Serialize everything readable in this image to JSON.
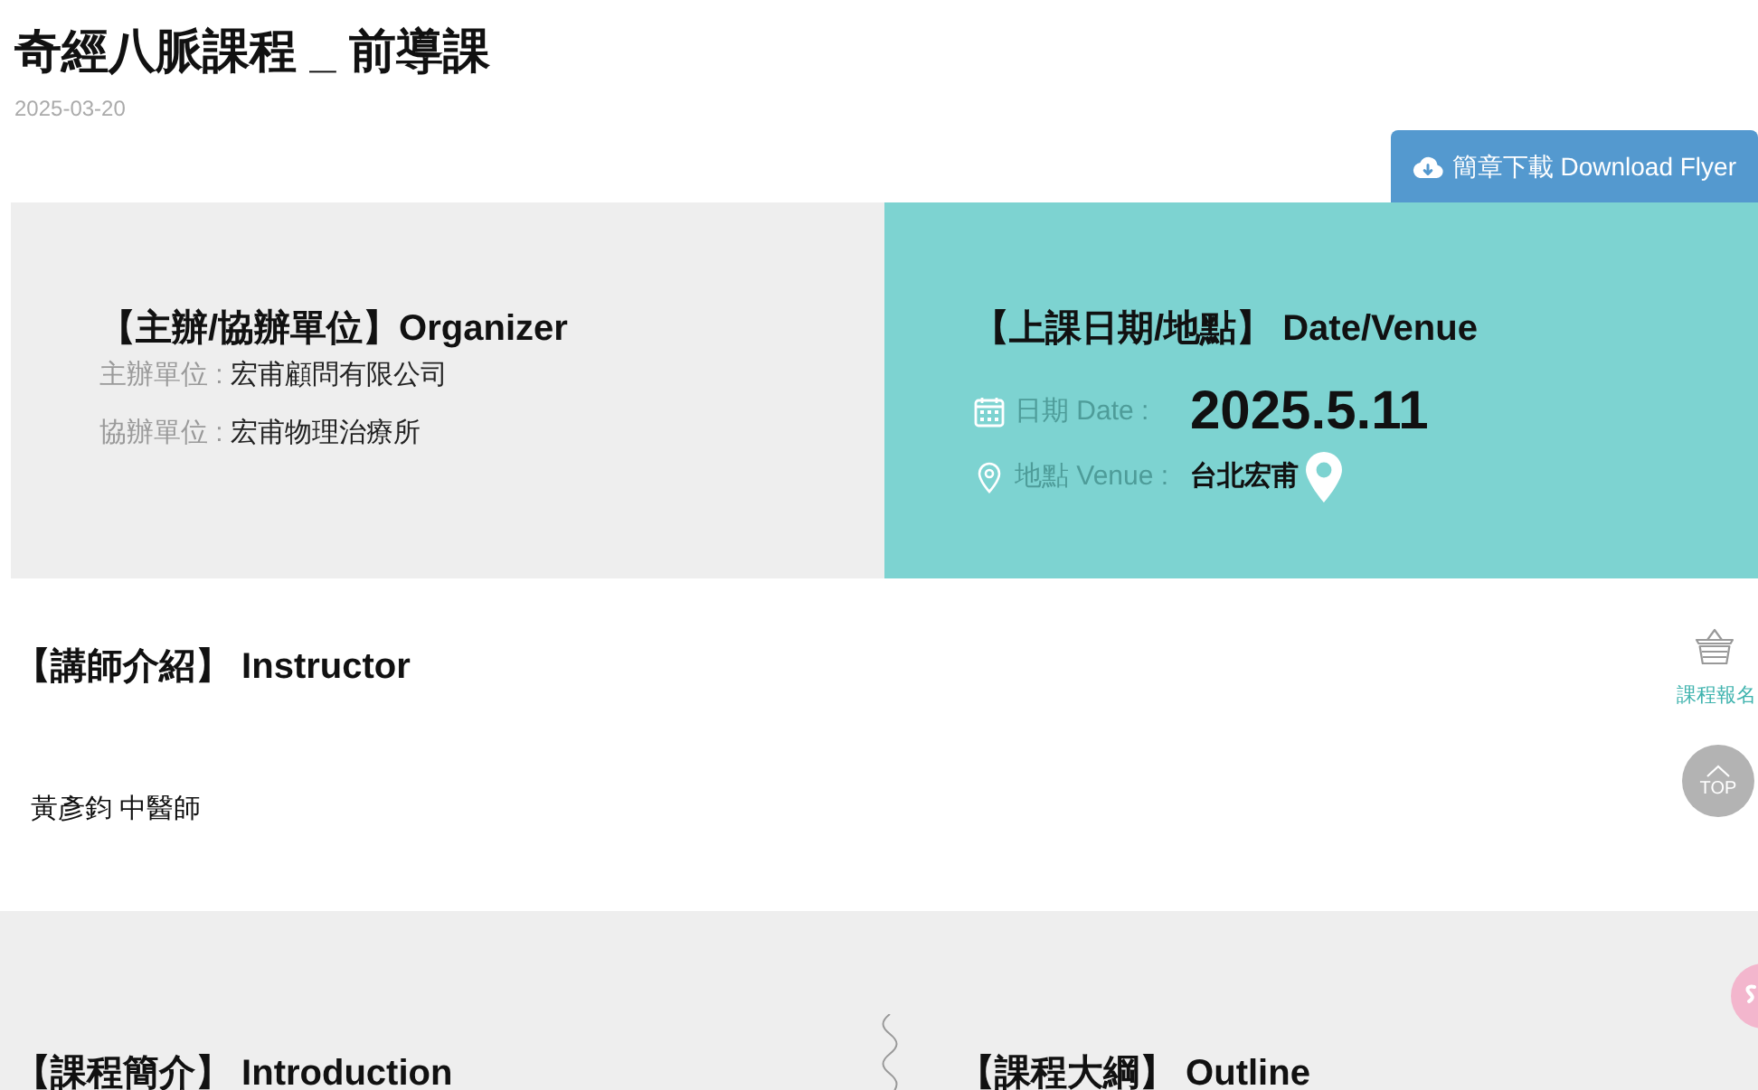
{
  "header": {
    "title": "奇經八脈課程 _ 前導課",
    "date": "2025-03-20"
  },
  "download_button": {
    "label": "簡章下載 Download Flyer"
  },
  "organizer": {
    "heading": "【主辦/協辦單位】Organizer",
    "rows": [
      {
        "label": "主辦單位 :",
        "value": "宏甫顧問有限公司"
      },
      {
        "label": "協辦單位 :",
        "value": "宏甫物理治療所"
      }
    ]
  },
  "schedule": {
    "heading": "【上課日期/地點】 Date/Venue",
    "rows": [
      {
        "kind": "date",
        "label": "日期 Date :",
        "value": "2025.5.11"
      },
      {
        "kind": "venue",
        "label": "地點 Venue :",
        "value": "台北宏甫"
      }
    ]
  },
  "instructor": {
    "heading": "【講師介紹】 Instructor",
    "name": "黃彥鈞 中醫師"
  },
  "details": {
    "sections": [
      {
        "heading": "【課程簡介】 Introduction"
      },
      {
        "heading": "【課程大綱】 Outline"
      }
    ]
  },
  "side_buttons": {
    "signup": "課程報名",
    "top": "TOP"
  }
}
